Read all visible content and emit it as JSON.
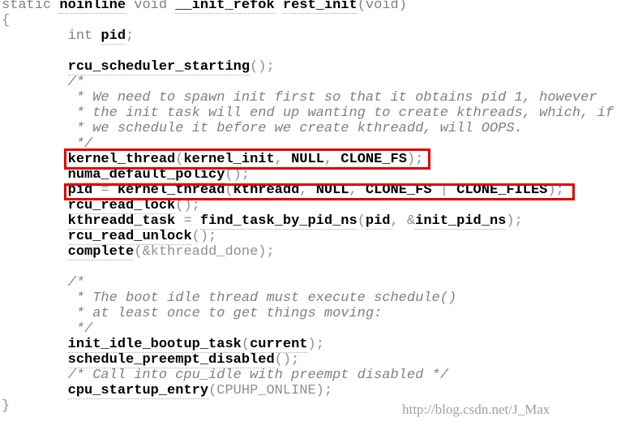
{
  "code_lines": [
    [
      [
        "static ",
        "kw"
      ],
      [
        "noinline",
        "id"
      ],
      [
        " void ",
        "kw"
      ],
      [
        "__init_refok",
        "id"
      ],
      [
        " ",
        "kw"
      ],
      [
        "rest_init",
        "id"
      ],
      [
        "(void)",
        "kw"
      ]
    ],
    [
      [
        "{",
        "p"
      ]
    ],
    [
      [
        "        int ",
        "kw"
      ],
      [
        "pid",
        "id"
      ],
      [
        ";",
        "p"
      ]
    ],
    [],
    [
      [
        "        ",
        "p"
      ],
      [
        "rcu_scheduler_starting",
        "id"
      ],
      [
        "();",
        "p"
      ]
    ],
    [
      [
        "        /*",
        "c"
      ]
    ],
    [
      [
        "         * We need to spawn init first so that it obtains pid 1, however",
        "c"
      ]
    ],
    [
      [
        "         * the init task will end up wanting to create kthreads, which, if",
        "c"
      ]
    ],
    [
      [
        "         * we schedule it before we create kthreadd, will OOPS.",
        "c"
      ]
    ],
    [
      [
        "         */",
        "c"
      ]
    ],
    [
      [
        "        ",
        "p"
      ],
      [
        "kernel_thread",
        "t"
      ],
      [
        "(",
        "p"
      ],
      [
        "kernel_init",
        "t"
      ],
      [
        ", ",
        "p"
      ],
      [
        "NULL",
        "t"
      ],
      [
        ", ",
        "p"
      ],
      [
        "CLONE_FS",
        "t"
      ],
      [
        ");",
        "p"
      ]
    ],
    [
      [
        "        ",
        "p"
      ],
      [
        "numa_default_policy",
        "id"
      ],
      [
        "();",
        "p"
      ]
    ],
    [
      [
        "        ",
        "p"
      ],
      [
        "pid",
        "t"
      ],
      [
        " = ",
        "p"
      ],
      [
        "kernel_thread",
        "t"
      ],
      [
        "(",
        "p"
      ],
      [
        "kthreadd",
        "t"
      ],
      [
        ", ",
        "p"
      ],
      [
        "NULL",
        "t"
      ],
      [
        ", ",
        "p"
      ],
      [
        "CLONE_FS",
        "t"
      ],
      [
        " | ",
        "p"
      ],
      [
        "CLONE_FILES",
        "t"
      ],
      [
        ");",
        "p"
      ]
    ],
    [
      [
        "        ",
        "p"
      ],
      [
        "rcu_read_lock",
        "id"
      ],
      [
        "();",
        "p"
      ]
    ],
    [
      [
        "        ",
        "p"
      ],
      [
        "kthreadd_task",
        "id"
      ],
      [
        " = ",
        "p"
      ],
      [
        "find_task_by_pid_ns",
        "id"
      ],
      [
        "(",
        "p"
      ],
      [
        "pid",
        "id"
      ],
      [
        ", &",
        "p"
      ],
      [
        "init_pid_ns",
        "id"
      ],
      [
        ");",
        "p"
      ]
    ],
    [
      [
        "        ",
        "p"
      ],
      [
        "rcu_read_unlock",
        "id"
      ],
      [
        "();",
        "p"
      ]
    ],
    [
      [
        "        ",
        "p"
      ],
      [
        "complete",
        "id"
      ],
      [
        "(&kthreadd_done);",
        "p"
      ]
    ],
    [],
    [
      [
        "        /*",
        "c"
      ]
    ],
    [
      [
        "         * The boot idle thread must execute schedule()",
        "c"
      ]
    ],
    [
      [
        "         * at least once to get things moving:",
        "c"
      ]
    ],
    [
      [
        "         */",
        "c"
      ]
    ],
    [
      [
        "        ",
        "p"
      ],
      [
        "init_idle_bootup_task",
        "id"
      ],
      [
        "(",
        "p"
      ],
      [
        "current",
        "id"
      ],
      [
        ");",
        "p"
      ]
    ],
    [
      [
        "        ",
        "p"
      ],
      [
        "schedule_preempt_disabled",
        "id"
      ],
      [
        "();",
        "p"
      ]
    ],
    [
      [
        "        /* Call into cpu_idle with preempt disabled */",
        "c"
      ]
    ],
    [
      [
        "        ",
        "p"
      ],
      [
        "cpu_startup_entry",
        "id"
      ],
      [
        "(CPUHP_ONLINE);",
        "p"
      ]
    ],
    [
      [
        "}",
        "p"
      ]
    ]
  ],
  "highlight_color": "#e00000",
  "watermark": "http://blog.csdn.net/J_Max"
}
